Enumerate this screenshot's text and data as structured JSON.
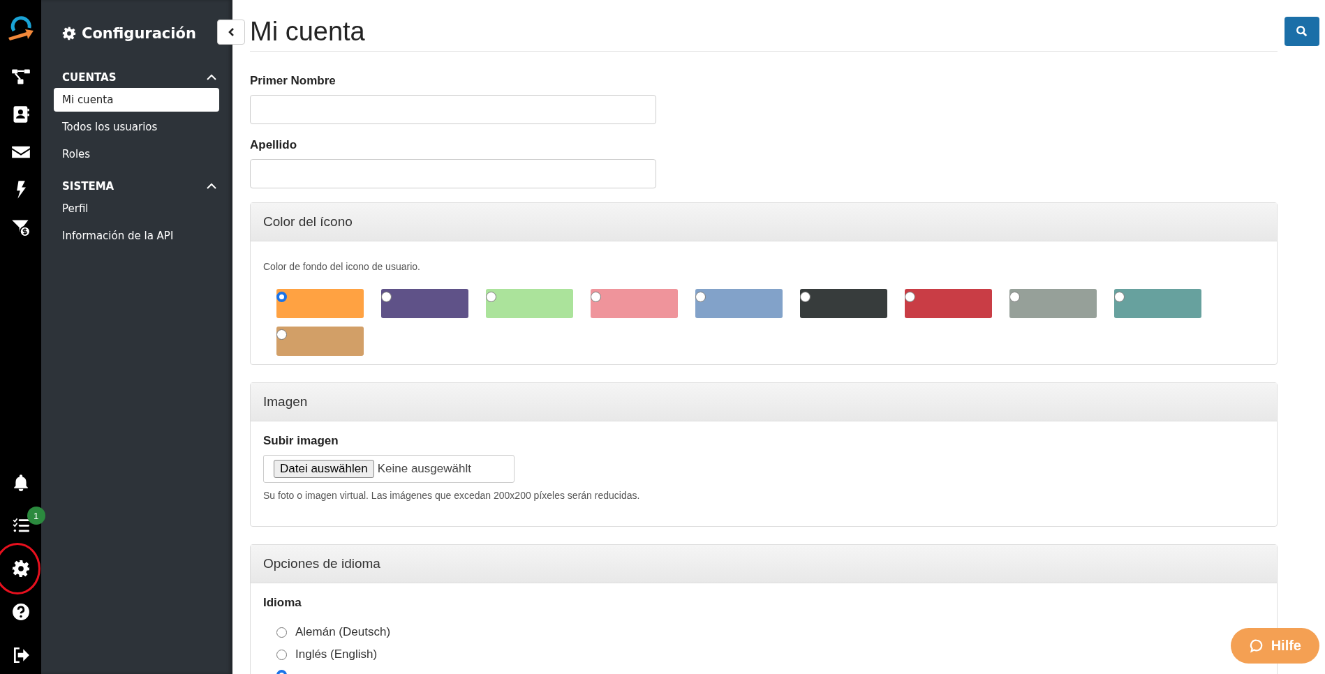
{
  "rail": {
    "top": [
      {
        "kind": "logo"
      },
      {
        "kind": "workflow"
      },
      {
        "kind": "contacts"
      },
      {
        "kind": "mail"
      },
      {
        "kind": "bolt"
      },
      {
        "kind": "funnel"
      }
    ],
    "bottom": [
      {
        "kind": "bell",
        "highlighted": false
      },
      {
        "kind": "tasks",
        "badge": "1",
        "highlighted": false
      },
      {
        "kind": "gear",
        "highlighted": true
      },
      {
        "kind": "help",
        "highlighted": false
      },
      {
        "kind": "logout",
        "highlighted": false
      }
    ]
  },
  "sidebar": {
    "title": "Configuración",
    "sections": [
      {
        "title": "CUENTAS",
        "expanded": true,
        "items": [
          {
            "label": "Mi cuenta",
            "selected": true
          },
          {
            "label": "Todos los usuarios",
            "selected": false
          },
          {
            "label": "Roles",
            "selected": false
          }
        ]
      },
      {
        "title": "SISTEMA",
        "expanded": true,
        "items": [
          {
            "label": "Perfil",
            "selected": false
          },
          {
            "label": "Información de la API",
            "selected": false
          }
        ]
      }
    ]
  },
  "page": {
    "title": "Mi cuenta"
  },
  "fields": [
    {
      "label": "Primer Nombre"
    },
    {
      "label": "Apellido"
    }
  ],
  "icon_color": {
    "title": "Color del ícono",
    "hint": "Color de fondo del icono de usuario.",
    "swatches": [
      {
        "color": "#ffa242",
        "selected": true
      },
      {
        "color": "#5f5288",
        "selected": false
      },
      {
        "color": "#abe39b",
        "selected": false
      },
      {
        "color": "#ef949b",
        "selected": false
      },
      {
        "color": "#82a2c9",
        "selected": false
      },
      {
        "color": "#373c3c",
        "selected": false
      },
      {
        "color": "#c93d45",
        "selected": false
      },
      {
        "color": "#96a099",
        "selected": false
      },
      {
        "color": "#67a19e",
        "selected": false
      },
      {
        "color": "#d29f67",
        "selected": false
      }
    ]
  },
  "image": {
    "title": "Imagen",
    "label": "Subir imagen",
    "button": "Datei auswählen",
    "file": "Keine ausgewählt",
    "help": "Su foto o imagen virtual. Las imágenes que excedan 200x200 píxeles serán reducidas."
  },
  "language": {
    "title": "Opciones de idioma",
    "label": "Idioma",
    "options": [
      {
        "label": "Alemán (Deutsch)",
        "selected": false
      },
      {
        "label": "Inglés (English)",
        "selected": false
      },
      {
        "selected": true
      }
    ]
  },
  "help_button": {
    "label": "Hilfe"
  }
}
